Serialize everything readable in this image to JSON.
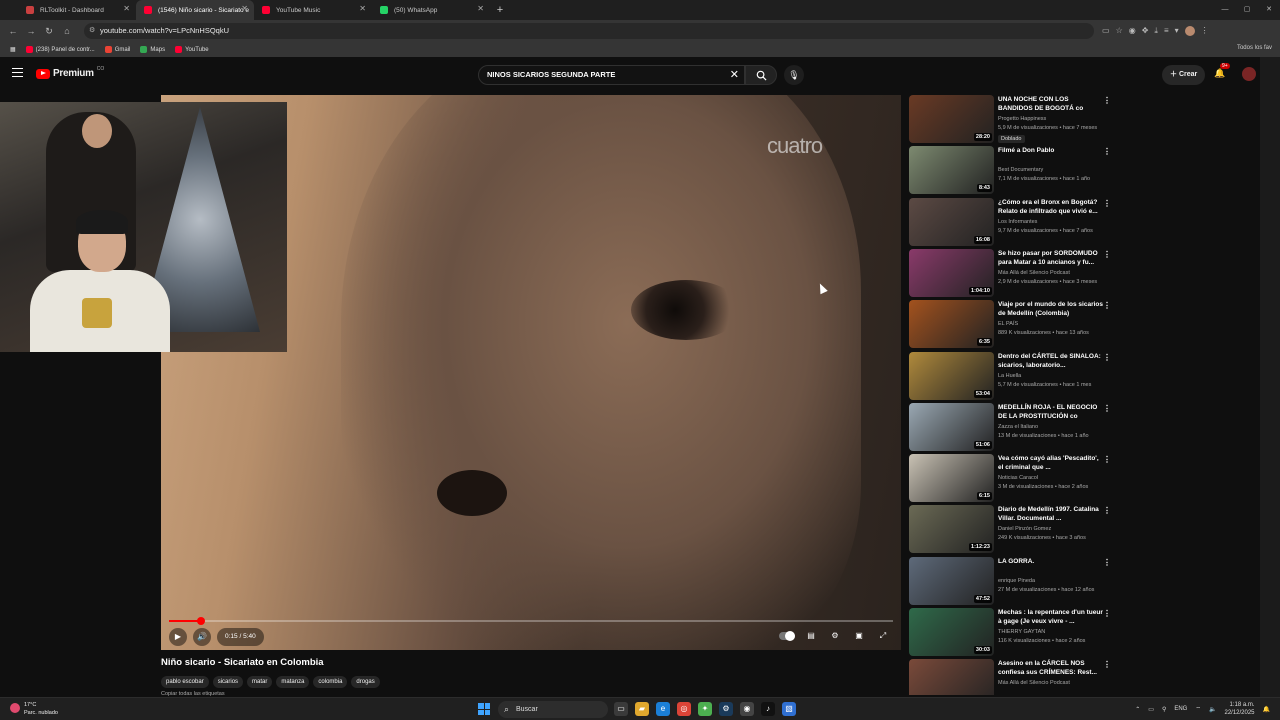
{
  "browser": {
    "tabs": [
      {
        "label": "RLToolkit - Dashboard",
        "color": "#c94040"
      },
      {
        "label": "(1546) Niño sicario - Sicariato e",
        "color": "#ff0033"
      },
      {
        "label": "YouTube Music",
        "color": "#ff0033"
      },
      {
        "label": "(50) WhatsApp",
        "color": "#25d366"
      }
    ],
    "url": "youtube.com/watch?v=LPcNnHSQqkU",
    "bookmarks": [
      {
        "label": "(238) Panel de contr...",
        "color": "#ff0033"
      },
      {
        "label": "Gmail",
        "color": "#ea4335"
      },
      {
        "label": "Maps",
        "color": "#34a853"
      },
      {
        "label": "YouTube",
        "color": "#ff0033"
      }
    ],
    "bookmarks_right": "Todos los fav"
  },
  "youtube": {
    "logo_text": "Premium",
    "logo_sup": "CO",
    "search_query": "NINOS SICARIOS SEGUNDA PARTE",
    "create_label": "Crear",
    "notif_badge": "9+"
  },
  "player": {
    "watermark": "cuatro",
    "time": "0:15 / 5:40",
    "progress_fraction": 0.044
  },
  "video": {
    "title": "Niño sicario - Sicariato en Colombia",
    "tags": [
      "pablo escobar",
      "sicarios",
      "matar",
      "matanza",
      "colombia",
      "drogas"
    ],
    "more_label": "Copiar todas las etiquetas"
  },
  "recommendations": [
    {
      "title": "UNA NOCHE CON LOS BANDIDOS DE BOGOTÁ co",
      "channel": "Progetto Happiness",
      "meta": "5,9 M de visualizaciones • hace 7 meses",
      "duration": "28:20",
      "badge": "Doblado",
      "thumb": "#6a3a24"
    },
    {
      "title": "Filmé a Don Pablo",
      "channel": "Best Documentary",
      "meta": "7,1 M de visualizaciones • hace 1 año",
      "duration": "8:43",
      "thumb": "#7d8a70"
    },
    {
      "title": "¿Cómo era el Bronx en Bogotá? Relato de infiltrado que vivió e...",
      "channel": "Los Informantes",
      "meta": "9,7 M de visualizaciones • hace 7 años",
      "duration": "16:08",
      "thumb": "#5c4a44"
    },
    {
      "title": "Se hizo pasar por SORDOMUDO para Matar a 10 ancianos y fu...",
      "channel": "Más Allá del Silencio Podcast",
      "meta": "2,9 M de visualizaciones • hace 3 meses",
      "duration": "1:04:10",
      "thumb": "#8a3a6a"
    },
    {
      "title": "Viaje por el mundo de los sicarios de Medellín (Colombia)",
      "channel": "EL PAÍS",
      "meta": "889 K visualizaciones • hace 13 años",
      "duration": "6:35",
      "thumb": "#a3521e"
    },
    {
      "title": "Dentro del CÁRTEL de SINALOA: sicarios, laboratorio...",
      "channel": "La Huella",
      "meta": "5,7 M de visualizaciones • hace 1 mes",
      "duration": "53:04",
      "thumb": "#b08a3c"
    },
    {
      "title": "MEDELLÍN ROJA - EL NEGOCIO DE LA PROSTITUCIÓN co",
      "channel": "Zazza el Italiano",
      "meta": "13 M de visualizaciones • hace 1 año",
      "duration": "51:06",
      "thumb": "#9aa8b3"
    },
    {
      "title": "Vea cómo cayó alias 'Pescadito', el criminal que ...",
      "channel": "Noticias Caracol",
      "meta": "3 M de visualizaciones • hace 2 años",
      "duration": "6:15",
      "thumb": "#c9c2b4"
    },
    {
      "title": "Diario de Medellín 1997. Catalina Villar. Documental ...",
      "channel": "Daniel Pinzón Gomez",
      "meta": "249 K visualizaciones • hace 3 años",
      "duration": "1:12:23",
      "thumb": "#6b6a55"
    },
    {
      "title": "LA GORRA.",
      "channel": "enrique Pineda",
      "meta": "27 M de visualizaciones • hace 12 años",
      "duration": "47:52",
      "thumb": "#5e6a7a"
    },
    {
      "title": "Mechas : la repentance d'un tueur à gage (Je veux vivre - ...",
      "channel": "THIERRY GAYTAN",
      "meta": "116 K visualizaciones • hace 2 años",
      "duration": "30:03",
      "thumb": "#2f6a4a"
    },
    {
      "title": "Asesino en la CÁRCEL NOS confiesa sus CRÍMENES: Rest...",
      "channel": "Más Allá del Silencio Podcast",
      "meta": "",
      "duration": "",
      "thumb": "#7a4a3a"
    }
  ],
  "taskbar": {
    "temp": "17°C",
    "weather": "Parc. nublado",
    "search": "Buscar",
    "lang": "ENG",
    "time": "1:18 a.m.",
    "date": "22/12/2025"
  }
}
